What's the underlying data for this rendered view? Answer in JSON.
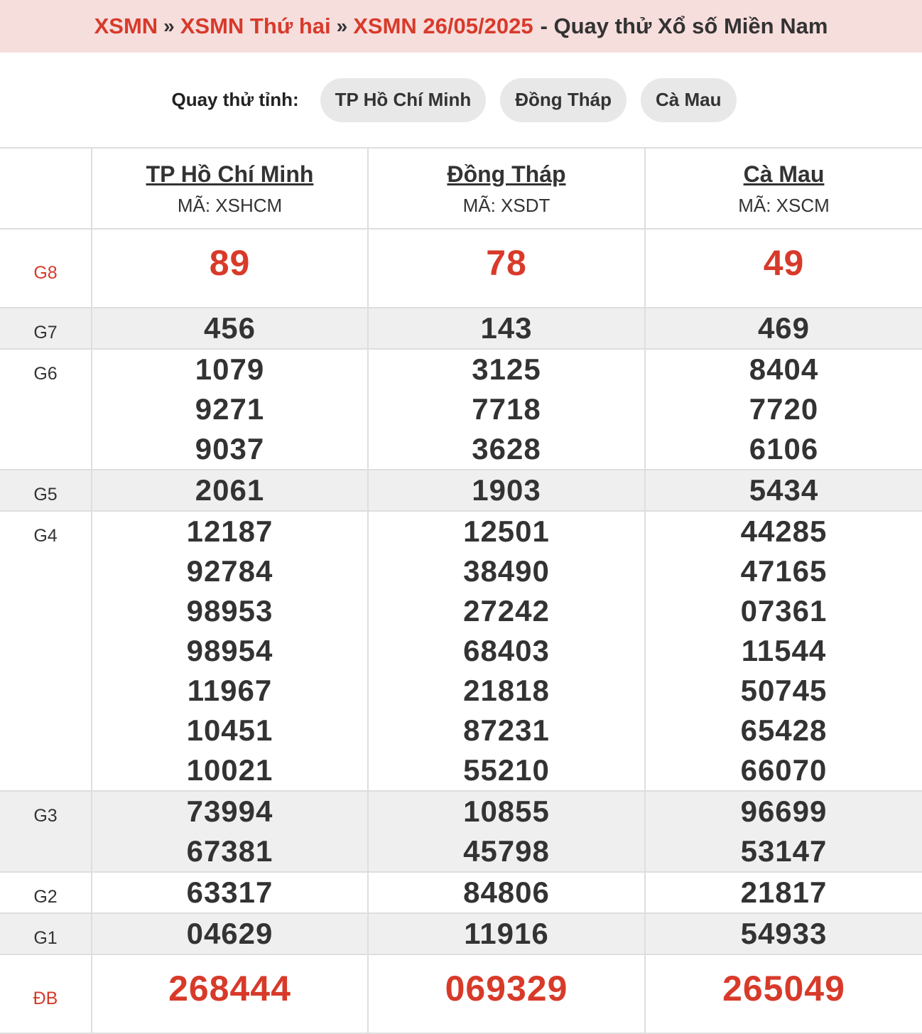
{
  "breadcrumb": {
    "crumb1": "XSMN",
    "sep": "»",
    "crumb2": "XSMN Thứ hai",
    "crumb3": "XSMN 26/05/2025",
    "tail": "- Quay thử Xổ số Miền Nam"
  },
  "province_bar": {
    "label": "Quay thử tỉnh:",
    "chips": [
      "TP Hồ Chí Minh",
      "Đồng Tháp",
      "Cà Mau"
    ]
  },
  "provinces": [
    {
      "name": "TP Hồ Chí Minh",
      "code": "MÃ: XSHCM"
    },
    {
      "name": "Đồng Tháp",
      "code": "MÃ: XSDT"
    },
    {
      "name": "Cà Mau",
      "code": "MÃ: XSCM"
    }
  ],
  "prizes": [
    {
      "label": "G8",
      "values": [
        [
          "89"
        ],
        [
          "78"
        ],
        [
          "49"
        ]
      ]
    },
    {
      "label": "G7",
      "values": [
        [
          "456"
        ],
        [
          "143"
        ],
        [
          "469"
        ]
      ]
    },
    {
      "label": "G6",
      "values": [
        [
          "1079",
          "9271",
          "9037"
        ],
        [
          "3125",
          "7718",
          "3628"
        ],
        [
          "8404",
          "7720",
          "6106"
        ]
      ]
    },
    {
      "label": "G5",
      "values": [
        [
          "2061"
        ],
        [
          "1903"
        ],
        [
          "5434"
        ]
      ]
    },
    {
      "label": "G4",
      "values": [
        [
          "12187",
          "92784",
          "98953",
          "98954",
          "11967",
          "10451",
          "10021"
        ],
        [
          "12501",
          "38490",
          "27242",
          "68403",
          "21818",
          "87231",
          "55210"
        ],
        [
          "44285",
          "47165",
          "07361",
          "11544",
          "50745",
          "65428",
          "66070"
        ]
      ]
    },
    {
      "label": "G3",
      "values": [
        [
          "73994",
          "67381"
        ],
        [
          "10855",
          "45798"
        ],
        [
          "96699",
          "53147"
        ]
      ]
    },
    {
      "label": "G2",
      "values": [
        [
          "63317"
        ],
        [
          "84806"
        ],
        [
          "21817"
        ]
      ]
    },
    {
      "label": "G1",
      "values": [
        [
          "04629"
        ],
        [
          "11916"
        ],
        [
          "54933"
        ]
      ]
    },
    {
      "label": "ĐB",
      "values": [
        [
          "268444"
        ],
        [
          "069329"
        ],
        [
          "265049"
        ]
      ]
    }
  ],
  "colors": {
    "accent": "#d83a2a",
    "header_bg": "#f6dedd",
    "chip_bg": "#e8e8e8",
    "alt_row_bg": "#efefef",
    "grid": "#dedede"
  }
}
